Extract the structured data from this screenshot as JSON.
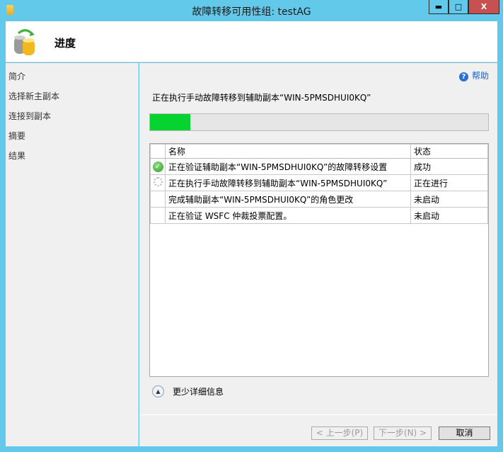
{
  "window": {
    "title": "故障转移可用性组: testAG",
    "minimize": "▬",
    "maximize": "□",
    "close": "X"
  },
  "header": {
    "title": "进度"
  },
  "sidebar": {
    "items": [
      {
        "label": "简介"
      },
      {
        "label": "选择新主副本"
      },
      {
        "label": "连接到副本"
      },
      {
        "label": "摘要"
      },
      {
        "label": "结果"
      }
    ]
  },
  "main": {
    "help": "帮助",
    "message": "正在执行手动故障转移到辅助副本“WIN-5PMSDHUI0KQ”",
    "progress_percent": 12,
    "columns": {
      "name": "名称",
      "status": "状态"
    },
    "rows": [
      {
        "icon": "success",
        "name": "正在验证辅助副本“WIN-5PMSDHUI0KQ”的故障转移设置",
        "status": "成功"
      },
      {
        "icon": "in-progress",
        "name": "正在执行手动故障转移到辅助副本“WIN-5PMSDHUI0KQ”",
        "status": "正在进行"
      },
      {
        "icon": "none",
        "name": "完成辅助副本“WIN-5PMSDHUI0KQ”的角色更改",
        "status": "未启动"
      },
      {
        "icon": "none",
        "name": "正在验证 WSFC 仲裁投票配置。",
        "status": "未启动"
      }
    ],
    "details_toggle": "更少详细信息"
  },
  "buttons": {
    "previous": "< 上一步(P)",
    "next": "下一步(N) >",
    "cancel": "取消"
  },
  "colors": {
    "titlebar": "#63c9ea",
    "progress": "#06d230",
    "close": "#c75050"
  }
}
